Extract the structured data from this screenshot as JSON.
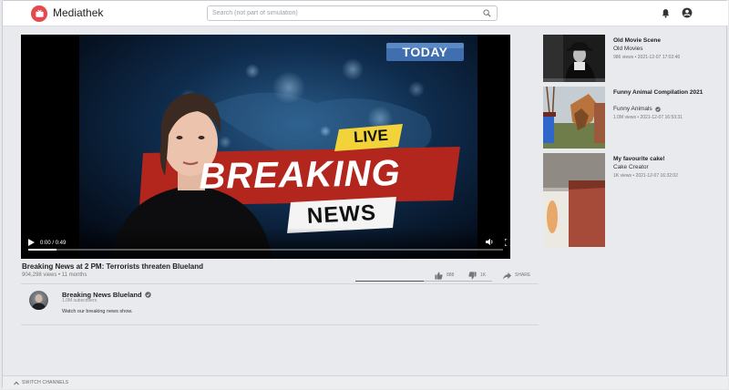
{
  "app": {
    "title": "Mediathek"
  },
  "search": {
    "placeholder": "Search (not part of simulation)"
  },
  "player": {
    "current_time": "0:00",
    "duration": "0:49",
    "time_display": "0:00 / 0:49",
    "progress": 0.06,
    "overlay": {
      "today": "TODAY",
      "live": "LIVE",
      "breaking": "BREAKING",
      "news": "NEWS"
    }
  },
  "video": {
    "title": "Breaking News at 2 PM: Terrorists threaten Blueland",
    "meta": "904,298 views • 11 months",
    "likes": "888",
    "dislikes": "1K",
    "share_label": "SHARE",
    "like_ratio": 0.5
  },
  "channel": {
    "name": "Breaking News Blueland",
    "subscribers": "1.0M subscribers",
    "description": "Watch our breaking news show."
  },
  "recommendations": [
    {
      "title": "Old Movie Scene",
      "channel": "Old Movies",
      "verified": false,
      "meta": "986 views • 2021-12-07 17:02:46"
    },
    {
      "title": "Funny Animal Compilation 2021",
      "channel": "Funny Animals",
      "verified": true,
      "meta": "1.0M views • 2021-12-07 16:53:31"
    },
    {
      "title": "My favourite cake!",
      "channel": "Cake Creator",
      "verified": false,
      "meta": "1K views • 2021-12-07 16:32:02"
    }
  ],
  "footer": {
    "switch_channels": "SWITCH CHANNELS"
  },
  "colors": {
    "logo": "#e5484d",
    "breaking_banner": "#b3261e",
    "live_banner": "#f2d43a",
    "today_banner": "#3f6fae"
  }
}
